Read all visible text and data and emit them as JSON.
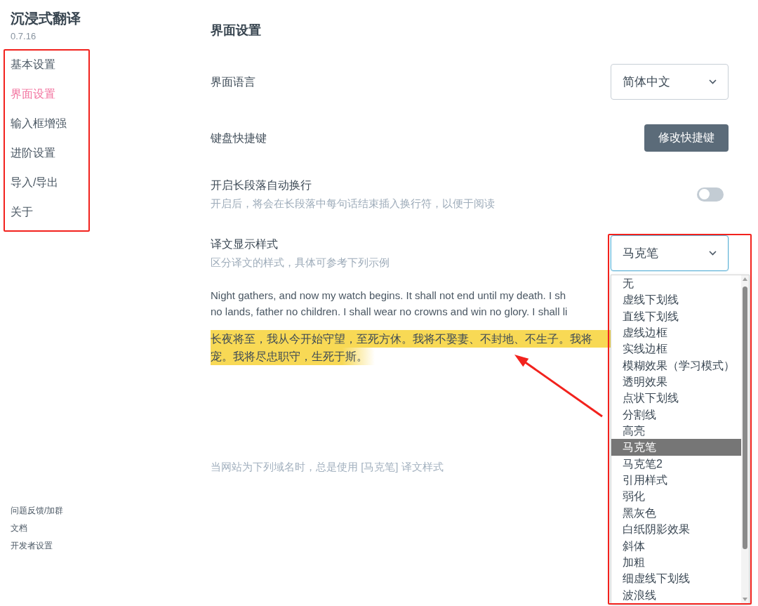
{
  "sidebar": {
    "title": "沉浸式翻译",
    "version": "0.7.16",
    "items": [
      {
        "label": "基本设置",
        "selected": false
      },
      {
        "label": "界面设置",
        "selected": true
      },
      {
        "label": "输入框增强",
        "selected": false
      },
      {
        "label": "进阶设置",
        "selected": false
      },
      {
        "label": "导入/导出",
        "selected": false
      },
      {
        "label": "关于",
        "selected": false
      }
    ],
    "footer_links": [
      "问题反馈/加群",
      "文档",
      "开发者设置"
    ]
  },
  "main": {
    "heading": "界面设置",
    "settings": [
      {
        "kind": "select",
        "label": "界面语言",
        "value": "简体中文",
        "focused": false
      },
      {
        "kind": "button",
        "label": "键盘快捷键",
        "button": "修改快捷键"
      },
      {
        "kind": "toggle",
        "label": "开启长段落自动换行",
        "description": "开启后，将会在长段落中每句话结束插入换行符，以便于阅读",
        "on": false
      },
      {
        "kind": "select",
        "label": "译文显示样式",
        "description": "区分译文的样式，具体可参考下列示例",
        "value": "马克笔",
        "focused": true,
        "expanded": true,
        "options": [
          {
            "label": "无",
            "selected": false
          },
          {
            "label": "虚线下划线",
            "selected": false
          },
          {
            "label": "直线下划线",
            "selected": false
          },
          {
            "label": "虚线边框",
            "selected": false
          },
          {
            "label": "实线边框",
            "selected": false
          },
          {
            "label": "模糊效果（学习模式）",
            "selected": false
          },
          {
            "label": "透明效果",
            "selected": false
          },
          {
            "label": "点状下划线",
            "selected": false
          },
          {
            "label": "分割线",
            "selected": false
          },
          {
            "label": "高亮",
            "selected": false
          },
          {
            "label": "马克笔",
            "selected": true
          },
          {
            "label": "马克笔2",
            "selected": false
          },
          {
            "label": "引用样式",
            "selected": false
          },
          {
            "label": "弱化",
            "selected": false
          },
          {
            "label": "黑灰色",
            "selected": false
          },
          {
            "label": "白纸阴影效果",
            "selected": false
          },
          {
            "label": "斜体",
            "selected": false
          },
          {
            "label": "加粗",
            "selected": false
          },
          {
            "label": "细虚线下划线",
            "selected": false
          },
          {
            "label": "波浪线",
            "selected": false
          }
        ]
      }
    ],
    "preview": {
      "original_lines": [
        "Night gathers, and now my watch begins. It shall not end until my death. I sh",
        "no lands, father no children. I shall wear no crowns and win no glory. I shall li"
      ],
      "translation_lines": [
        "长夜将至，我从今开始守望，至死方休。我将不娶妻、不封地、不生子。我将",
        "宠。我将尽忠职守，生死于斯。"
      ]
    },
    "site_rule": "当网站为下列域名时，总是使用 [马克笔] 译文样式"
  }
}
